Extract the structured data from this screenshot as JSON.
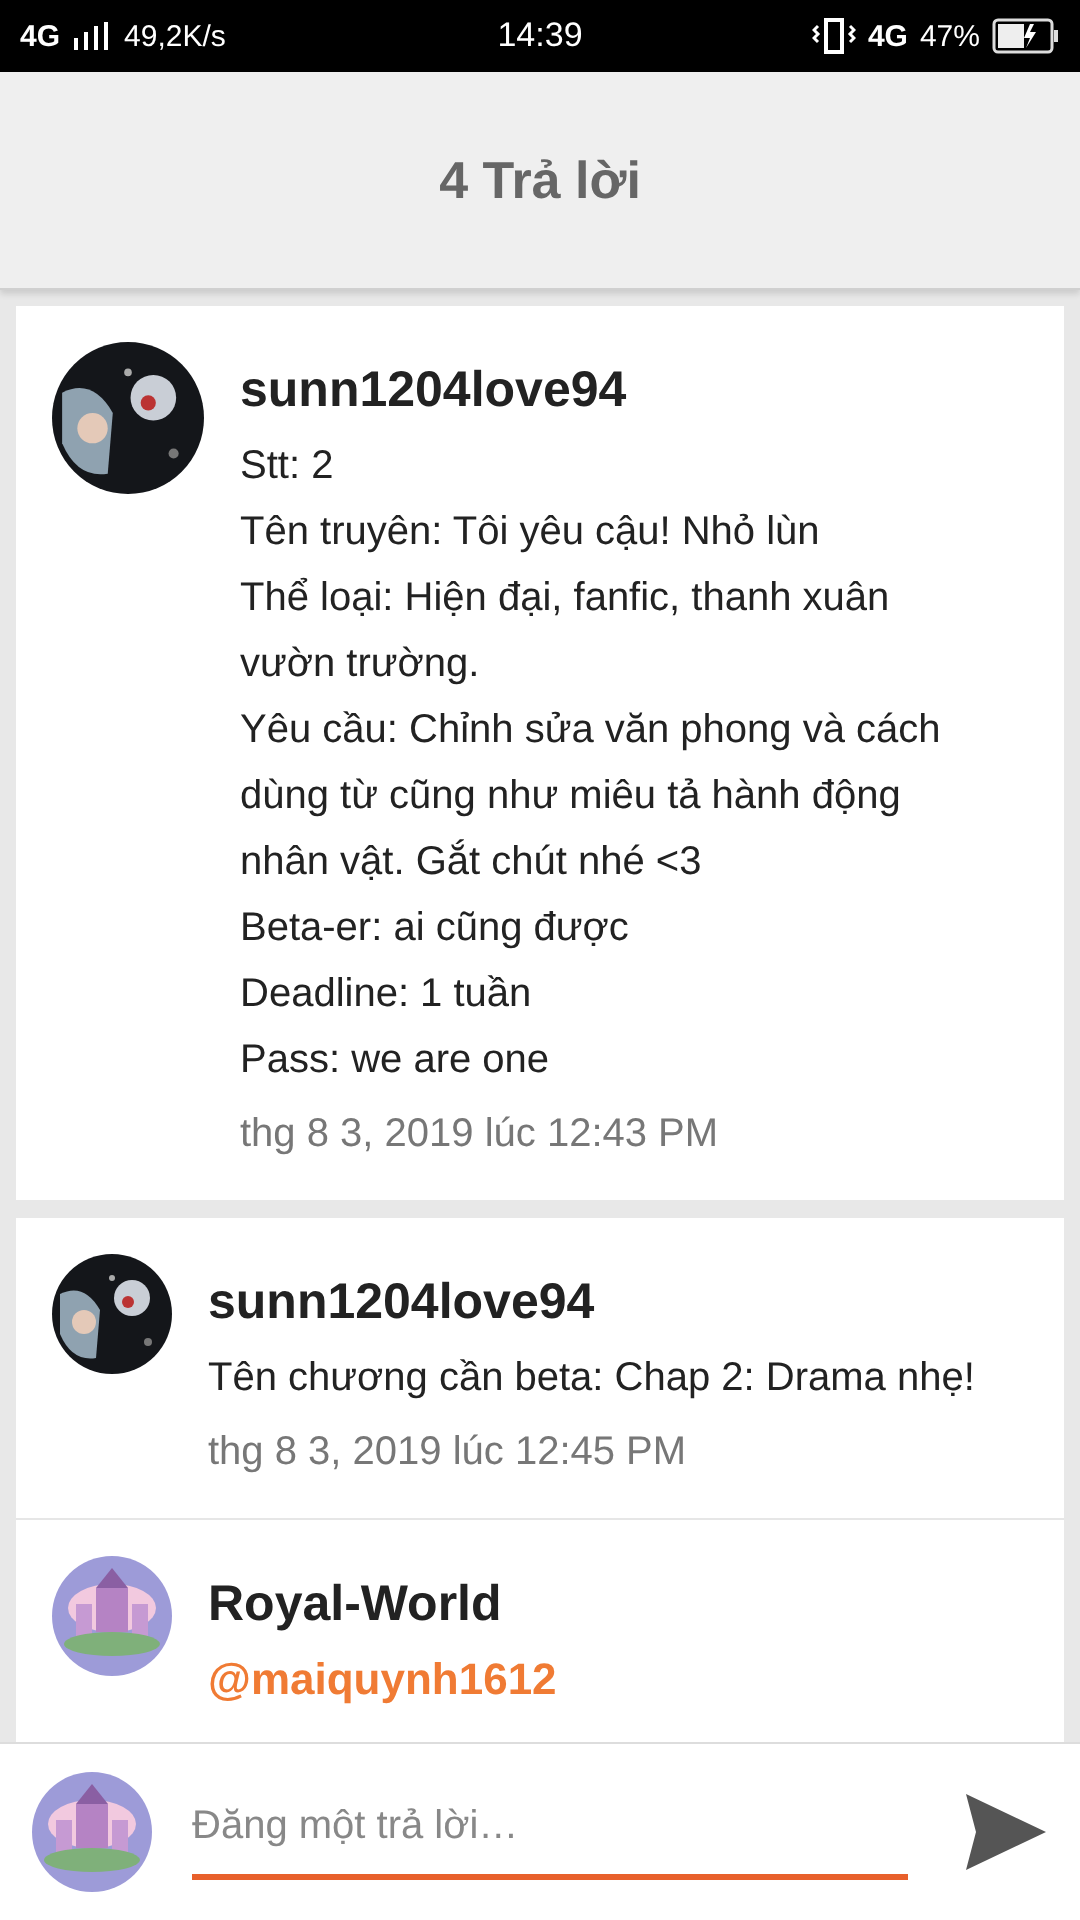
{
  "status_bar": {
    "network": "4G",
    "speed": "49,2K/s",
    "time": "14:39",
    "data_network": "4G",
    "battery": "47%"
  },
  "header": {
    "title": "4 Trả lời"
  },
  "cards": [
    {
      "comments": [
        {
          "author": "sunn1204love94",
          "avatar": {
            "kind": "picture"
          },
          "lines": [
            "Stt: 2",
            "Tên truyên: Tôi yêu cậu! Nhỏ lùn",
            "Thể loại: Hiện đại, fanfic, thanh xuân vườn trường.",
            "Yêu cầu: Chỉnh sửa văn phong và cách dùng từ cũng như miêu tả hành động nhân vật. Gắt chút nhé <3",
            "Beta-er: ai cũng được",
            "Deadline: 1 tuần",
            "Pass: we are one"
          ],
          "timestamp": "thg 8 3, 2019 lúc 12:43 PM"
        }
      ]
    },
    {
      "comments": [
        {
          "author": "sunn1204love94",
          "avatar": {
            "kind": "picture"
          },
          "lines": [
            "Tên chương cần beta: Chap 2: Drama nhẹ!"
          ],
          "timestamp": "thg 8 3, 2019 lúc 12:45 PM"
        },
        {
          "author": "Royal-World",
          "avatar": {
            "kind": "picture"
          },
          "mention": "@maiquynh1612"
        }
      ]
    }
  ],
  "reply_bar": {
    "avatar": {
      "kind": "picture"
    },
    "placeholder": "Đăng một trả lời…"
  }
}
